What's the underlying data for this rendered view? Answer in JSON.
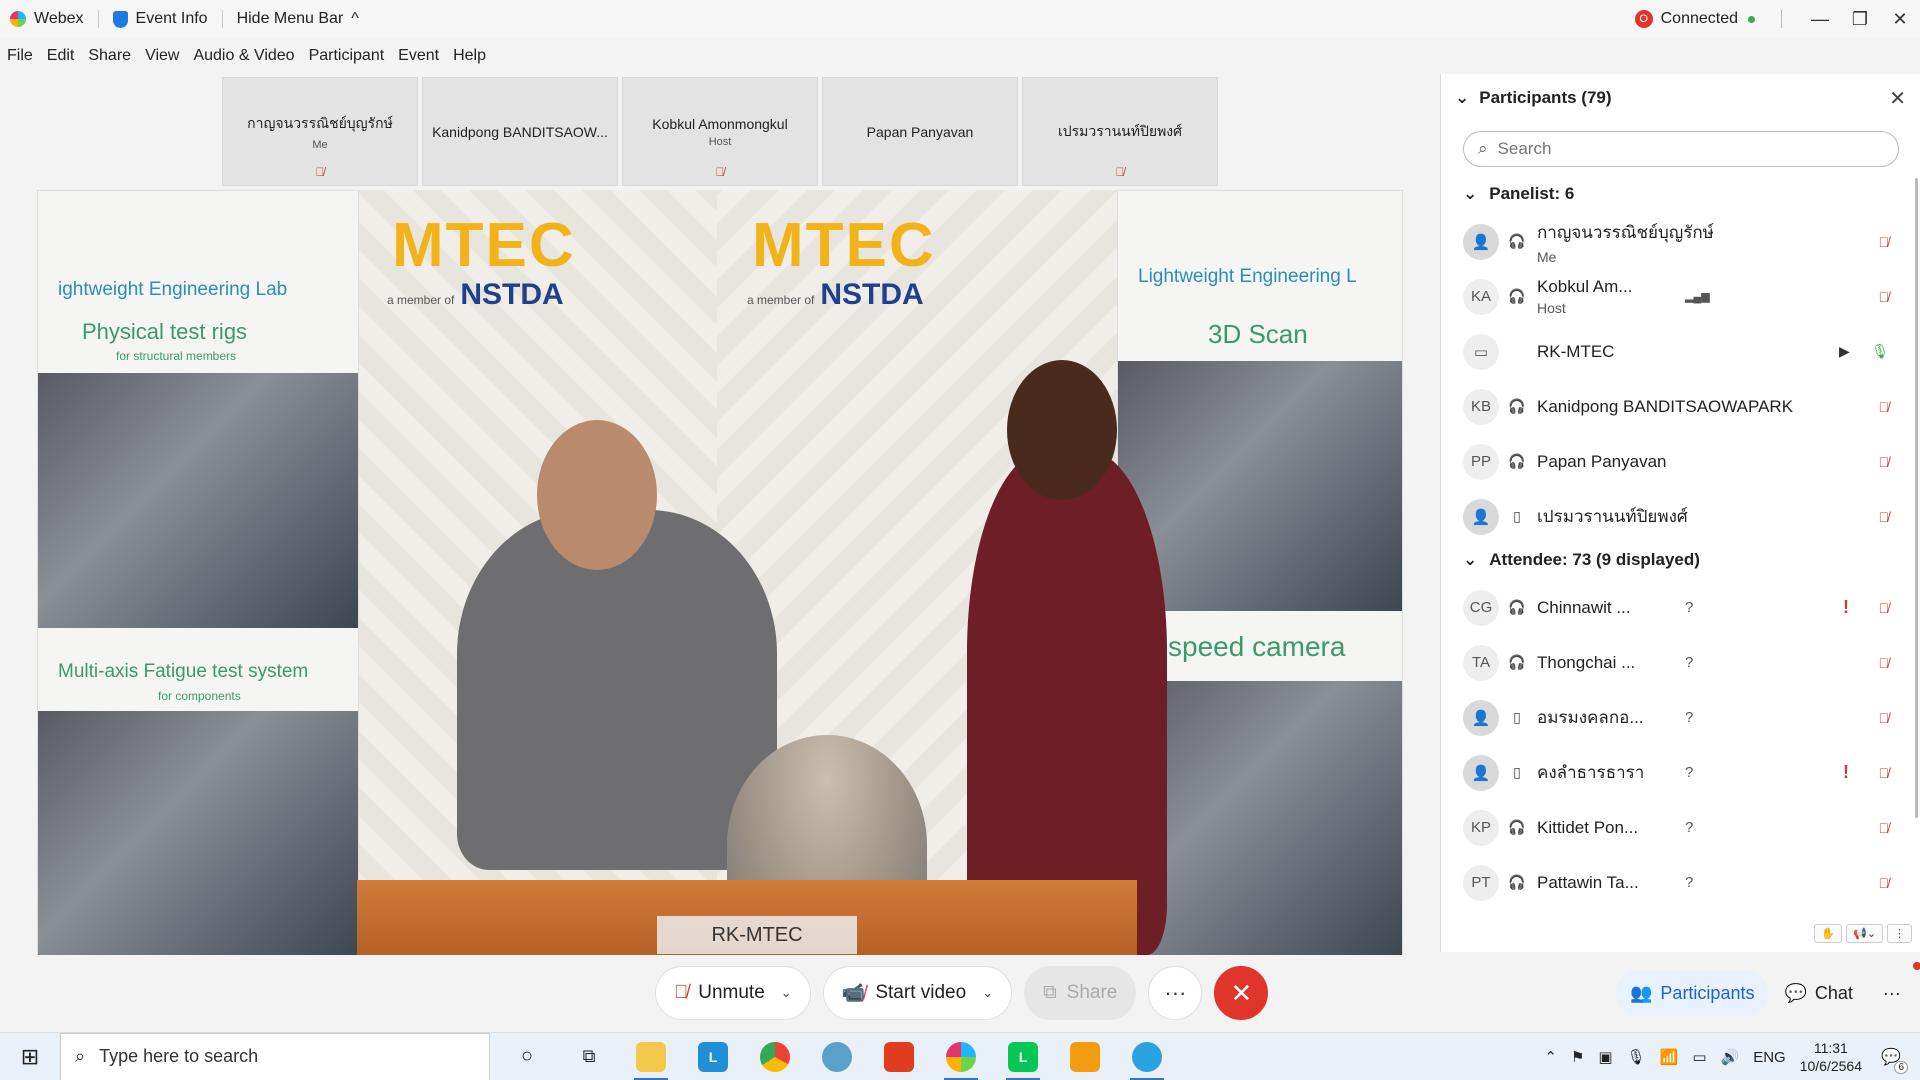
{
  "titlebar": {
    "app_name": "Webex",
    "event_info": "Event Info",
    "hide_menu": "Hide Menu Bar",
    "hide_menu_chevron": "^",
    "rec_badge": "O",
    "status": "Connected",
    "minimize": "—",
    "restore": "❐",
    "close": "✕"
  },
  "menu": [
    "File",
    "Edit",
    "Share",
    "View",
    "Audio & Video",
    "Participant",
    "Event",
    "Help"
  ],
  "thumbnails": [
    {
      "name": "กาญจนวรรณิชย์บุญรักษ์",
      "sub": "Me",
      "muted": true
    },
    {
      "name": "Kanidpong BANDITSAOW...",
      "sub": "",
      "muted": false
    },
    {
      "name": "Kobkul Amonmongkul",
      "sub": "Host",
      "muted": true
    },
    {
      "name": "Papan Panyavan",
      "sub": "",
      "muted": false
    },
    {
      "name": "เปรมวรานนท์ปิยพงศ์",
      "sub": "",
      "muted": true
    }
  ],
  "video": {
    "name_tag": "RK-MTEC",
    "brand": "MTEC",
    "member_of": "a member of",
    "nstda": "NSTDA",
    "left_banner_title": "ightweight Engineering Lab",
    "left_banner_h1": "Physical test rigs",
    "left_banner_h1_sub": "for structural members",
    "left_banner_h2": "Multi-axis Fatigue test system",
    "left_banner_h2_sub": "for components",
    "right_banner_title": "Lightweight Engineering L",
    "right_banner_h1": "3D Scan",
    "right_banner_h2": "speed camera"
  },
  "controls": {
    "unmute": "Unmute",
    "start_video": "Start video",
    "share": "Share",
    "more": "···",
    "end": "✕"
  },
  "panel": {
    "title": "Participants (79)",
    "search_placeholder": "Search",
    "panelist_header": "Panelist: 6",
    "attendee_header": "Attendee: 73 (9 displayed)",
    "panelists": [
      {
        "initials": "",
        "name": "กาญจนวรรณิชย์บุญรักษ์",
        "role": "Me",
        "device": "headset",
        "mic": "muted"
      },
      {
        "initials": "KA",
        "name": "Kobkul Am...",
        "role": "Host",
        "device": "headset",
        "mic": "muted"
      },
      {
        "initials": "",
        "name": "RK-MTEC",
        "role": "",
        "device": "room",
        "mic": "on"
      },
      {
        "initials": "KB",
        "name": "Kanidpong BANDITSAOWAPARK",
        "role": "",
        "device": "headset",
        "mic": "muted"
      },
      {
        "initials": "PP",
        "name": "Papan Panyavan",
        "role": "",
        "device": "headset",
        "mic": "muted"
      },
      {
        "initials": "",
        "name": "เปรมวรานนท์ปิยพงศ์",
        "role": "",
        "device": "phone",
        "mic": "muted"
      }
    ],
    "attendees": [
      {
        "initials": "CG",
        "name": "Chinnawit ...",
        "q": "?",
        "alert": "!"
      },
      {
        "initials": "TA",
        "name": "Thongchai ...",
        "q": "?",
        "alert": ""
      },
      {
        "initials": "",
        "name": "อมรมงคลกอ...",
        "q": "?",
        "alert": ""
      },
      {
        "initials": "",
        "name": "คงลำธารธารา",
        "q": "?",
        "alert": "!"
      },
      {
        "initials": "KP",
        "name": "Kittidet Pon...",
        "q": "?",
        "alert": ""
      },
      {
        "initials": "PT",
        "name": "Pattawin Ta...",
        "q": "?",
        "alert": ""
      }
    ],
    "tabs": {
      "participants": "Participants",
      "chat": "Chat",
      "more": "···"
    }
  },
  "taskbar": {
    "search_placeholder": "Type here to search",
    "language": "ENG",
    "time": "11:31",
    "date": "10/6/2564",
    "notif_count": "6"
  }
}
